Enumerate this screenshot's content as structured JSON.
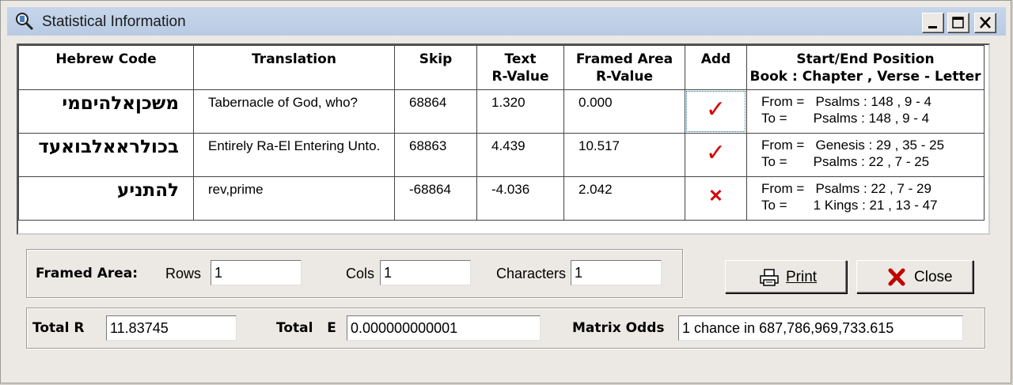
{
  "window": {
    "title": "Statistical Information",
    "controls": [
      "minimize",
      "maximize",
      "close"
    ]
  },
  "grid": {
    "columns": [
      {
        "label": "Hebrew Code"
      },
      {
        "label": "Translation"
      },
      {
        "label": "Skip"
      },
      {
        "label": "Text\nR-Value"
      },
      {
        "label": "Framed Area\nR-Value"
      },
      {
        "label": "Add"
      },
      {
        "label": "Start/End Position\nBook : Chapter , Verse - Letter"
      }
    ],
    "rows": [
      {
        "hebrew": "משכןאלהיםמי",
        "translation": "Tabernacle of God, who?",
        "skip": "68864",
        "text_r": "1.320",
        "framed_r": "0.000",
        "add": "check",
        "from_label": "From =",
        "from": "Psalms : 148 , 9 - 4",
        "to_label": "To =",
        "to": "Psalms : 148 , 9 - 4"
      },
      {
        "hebrew": "בכולראאלבואעד",
        "translation": "Entirely Ra-El Entering Unto.",
        "skip": "68863",
        "text_r": "4.439",
        "framed_r": "10.517",
        "add": "check",
        "from_label": "From =",
        "from": "Genesis : 29 , 35 - 25",
        "to_label": "To =",
        "to": "Psalms : 22 , 7 - 25"
      },
      {
        "hebrew": "להתניע",
        "translation": "rev,prime",
        "skip": "-68864",
        "text_r": "-4.036",
        "framed_r": "2.042",
        "add": "cross",
        "from_label": "From =",
        "from": "Psalms : 22 , 7 - 29",
        "to_label": "To =",
        "to": "1 Kings : 21 , 13 - 47"
      }
    ]
  },
  "framed_area": {
    "label": "Framed Area:",
    "rows_label": "Rows",
    "rows_value": "1",
    "cols_label": "Cols",
    "cols_value": "1",
    "chars_label": "Characters",
    "chars_value": "1"
  },
  "buttons": {
    "print_label": "Print",
    "close_label": "Close"
  },
  "totals": {
    "total_r_label": "Total R",
    "total_r_value": "11.83745",
    "total_e_label": "Total   E",
    "total_e_value": "0.000000000001",
    "matrix_odds_label": "Matrix Odds",
    "matrix_odds_value": "1 chance in 687,786,969,733.615"
  },
  "colors": {
    "title_bar": "#c1d2e8",
    "mark_red": "#d80000",
    "window_bg": "#ece9e4"
  }
}
